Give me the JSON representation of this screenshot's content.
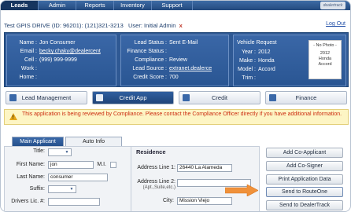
{
  "nav": {
    "tabs": [
      "Leads",
      "Admin",
      "Reports",
      "Inventory",
      "Support"
    ],
    "logo": "dealertrack"
  },
  "infobar": {
    "dealer": "Test GPIS DRIVE (ID: 96201): (121)321-3213",
    "user": "User: Initial Admin",
    "close": "x",
    "logout": "Log Out"
  },
  "consumer": {
    "name_label": "Name :",
    "name": "Jon Consumer",
    "email_label": "Email :",
    "email": "becky.chaky@dealercent",
    "cell_label": "Cell :",
    "cell": "(999) 999-9999",
    "work_label": "Work :",
    "work": "",
    "home_label": "Home :",
    "home": ""
  },
  "lead": {
    "status_label": "Lead Status :",
    "status": "Sent E-Mail",
    "finance_label": "Finance Status :",
    "finance": "",
    "compliance_label": "Compliance :",
    "compliance": "Review",
    "source_label": "Lead Source :",
    "source": "extranet.dealerce",
    "credit_label": "Credit Score :",
    "credit": "700"
  },
  "vehicle": {
    "request_label": "Vehicle Request",
    "year_label": "Year :",
    "year": "2012",
    "make_label": "Make :",
    "make": "Honda",
    "model_label": "Model :",
    "model": "Accord",
    "trim_label": "Trim :",
    "trim": "",
    "photo_line1": "- No Photo -",
    "photo_line2": "2012",
    "photo_line3": "Honda",
    "photo_line4": "Accord"
  },
  "sections": [
    "Lead Management",
    "Credit App",
    "Credit",
    "Finance"
  ],
  "warning": "This application is being reviewed by Compliance. Please contact the Compliance Officer directly if you have additional information.",
  "form": {
    "tabs": [
      "Main Applicant",
      "Auto Info"
    ],
    "title_label": "Title:",
    "first_label": "First Name:",
    "first_value": "jon",
    "mi_label": "M.I.",
    "last_label": "Last Name:",
    "last_value": "consumer",
    "suffix_label": "Suffix:",
    "dl_label": "Drivers Lic. #:",
    "residence_title": "Residence",
    "addr1_label": "Address Line 1:",
    "addr1_value": "26440 La Alameda",
    "addr2_label": "Address Line 2:",
    "addr2_hint": "(Apt.,Suite,etc.)",
    "city_label": "City:",
    "city_value": "Mission Viejo"
  },
  "actions": [
    "Add Co-Applicant",
    "Add Co-Signer",
    "Print Application Data",
    "Send to RouteOne",
    "Send to DealerTrack"
  ],
  "colors": {
    "panel": "#2f5994",
    "warning_text": "#cc2c10",
    "arrow": "#f0913a"
  }
}
